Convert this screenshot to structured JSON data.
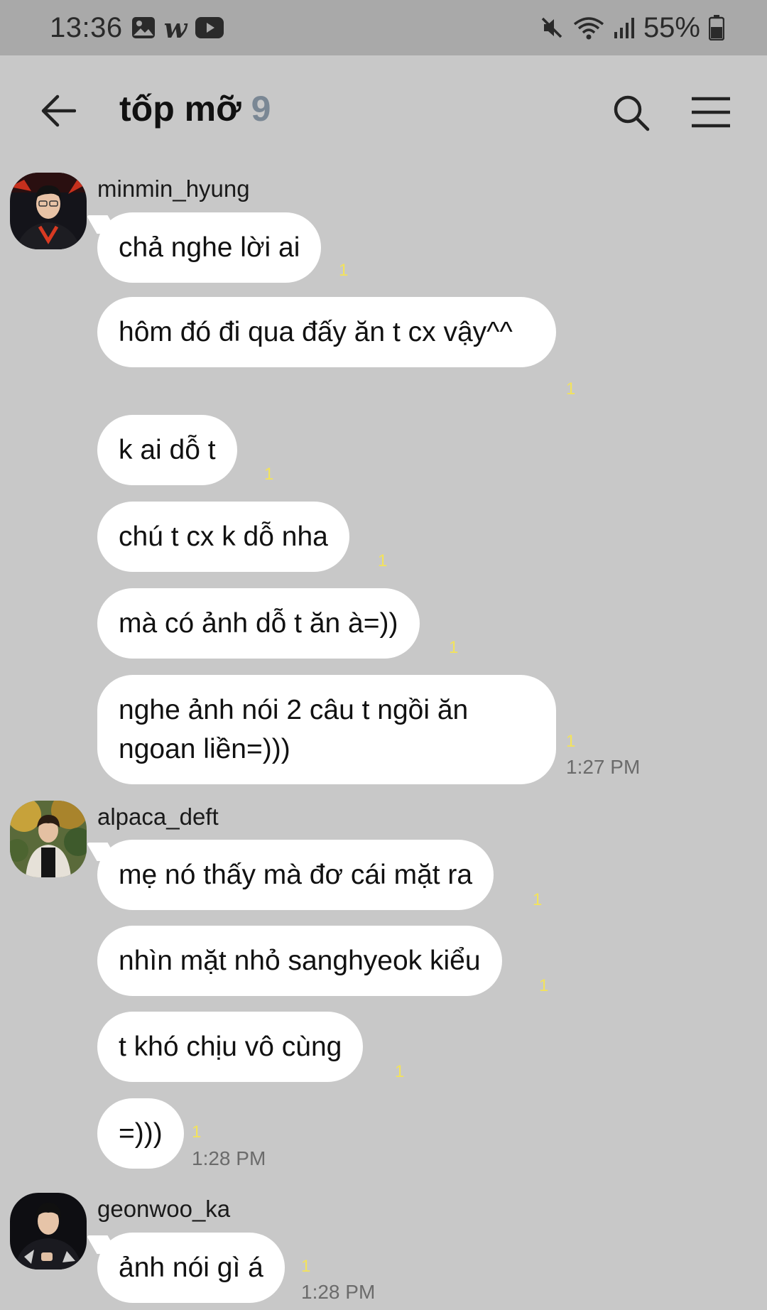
{
  "status_bar": {
    "time": "13:36",
    "battery_percent": "55%",
    "left_icons": [
      "gallery-icon",
      "w-app-icon",
      "youtube-icon"
    ],
    "right_icons": [
      "mute-icon",
      "wifi-icon",
      "signal-icon",
      "battery-icon"
    ],
    "w_glyph": "w"
  },
  "header": {
    "title": "tốp mỡ",
    "member_count": "9"
  },
  "colors": {
    "background": "#c8c8c8",
    "status_bar": "#a9a9a9",
    "bubble": "#ffffff",
    "unread": "#f3e35a",
    "timestamp": "#6b6b6b",
    "member_count": "#7a8794"
  },
  "messages": [
    {
      "sender": "minmin_hyung",
      "texts": [
        "chả nghe lời ai",
        "hôm đó đi qua đấy ăn t cx vậy^^",
        "k ai dỗ t",
        "chú t cx k dỗ nha",
        "mà có ảnh dỗ t ăn à=))",
        "nghe ảnh nói 2 câu t ngồi ăn ngoan liền=)))"
      ],
      "unread": [
        "1",
        "1",
        "1",
        "1",
        "1",
        "1"
      ],
      "time": "1:27 PM"
    },
    {
      "sender": "alpaca_deft",
      "texts": [
        "mẹ nó thấy mà đơ cái mặt ra",
        "nhìn mặt nhỏ sanghyeok kiểu",
        "t khó chịu vô cùng",
        "=)))"
      ],
      "unread": [
        "1",
        "1",
        "1",
        "1"
      ],
      "time": "1:28 PM"
    },
    {
      "sender": "geonwoo_ka",
      "texts": [
        "ảnh nói gì á"
      ],
      "unread": [
        "1"
      ],
      "time": "1:28 PM"
    }
  ]
}
